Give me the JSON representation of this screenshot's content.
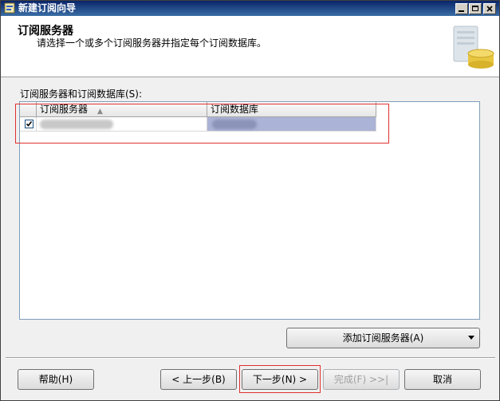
{
  "window": {
    "title": "新建订阅向导"
  },
  "header": {
    "title": "订阅服务器",
    "subtitle": "请选择一个或多个订阅服务器并指定每个订阅数据库。"
  },
  "grid": {
    "label": "订阅服务器和订阅数据库(S):",
    "columns": [
      "订阅服务器",
      "订阅数据库"
    ],
    "rows": [
      {
        "checked": true,
        "subscriber": "",
        "database": ""
      }
    ]
  },
  "buttons": {
    "add_subscriber": "添加订阅服务器(A)",
    "help": "帮助(H)",
    "back": "< 上一步(B)",
    "next": "下一步(N) >",
    "finish": "完成(F) >>|",
    "cancel": "取消"
  },
  "icons": {
    "window": "wizard-icon",
    "header_art": "database-icon",
    "checkbox": "checkmark-icon",
    "sort": "sort-ascending-icon",
    "dropdown": "chevron-down-icon"
  },
  "colors": {
    "titlebar": "#0a246a",
    "selection": "#abb3d6",
    "annotation": "#e03030"
  }
}
